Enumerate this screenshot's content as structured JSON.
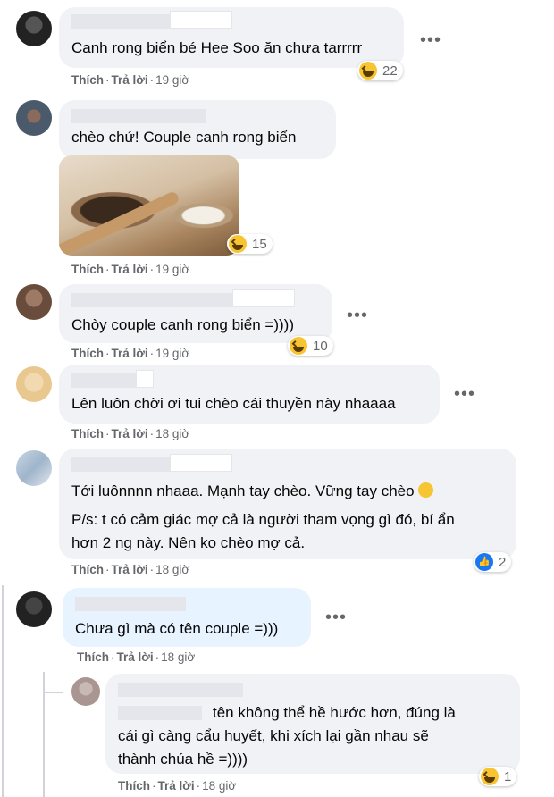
{
  "comments": [
    {
      "text": "Canh rong biển bé Hee Soo ăn chưa tarrrrr",
      "like": "Thích",
      "reply": "Trả lời",
      "time": "19 giờ",
      "reaction_count": "22"
    },
    {
      "text": "chèo chứ! Couple canh rong biển",
      "like": "Thích",
      "reply": "Trả lời",
      "time": "19 giờ",
      "reaction_count": "15"
    },
    {
      "text": "Chòy couple canh rong biển =))))",
      "like": "Thích",
      "reply": "Trả lời",
      "time": "19 giờ",
      "reaction_count": "10"
    },
    {
      "text": "Lên luôn chời ơi tui chèo cái thuyền này nhaaaa",
      "like": "Thích",
      "reply": "Trả lời",
      "time": "18 giờ"
    },
    {
      "text1": "Tới luônnnn nhaaa. Mạnh tay chèo. Vững tay chèo",
      "text2": "P/s: t có cảm giác mợ cả là người tham vọng gì đó, bí ẩn",
      "text3": "hơn 2 ng này. Nên ko chèo mợ cả.",
      "like": "Thích",
      "reply": "Trả lời",
      "time": "18 giờ",
      "reaction_count": "2"
    },
    {
      "text": "Chưa gì mà có tên couple =)))",
      "like": "Thích",
      "reply": "Trả lời",
      "time": "18 giờ"
    },
    {
      "text1": "tên không thể hề hước hơn, đúng là",
      "text2": "cái gì càng cẩu huyết, khi xích lại gần nhau sẽ",
      "text3": "thành chúa hề =))))",
      "like": "Thích",
      "reply": "Trả lời",
      "time": "18 giờ",
      "reaction_count": "1"
    }
  ],
  "icons": {
    "more": "more-icon",
    "haha": "haha-reaction-icon",
    "like": "like-reaction-icon"
  },
  "colors": {
    "bubble": "#f0f2f5",
    "bubble_highlight": "#e7f3ff",
    "meta": "#65676b",
    "like_blue": "#1877f2"
  },
  "dots_glyph": "•••",
  "sep": "·"
}
